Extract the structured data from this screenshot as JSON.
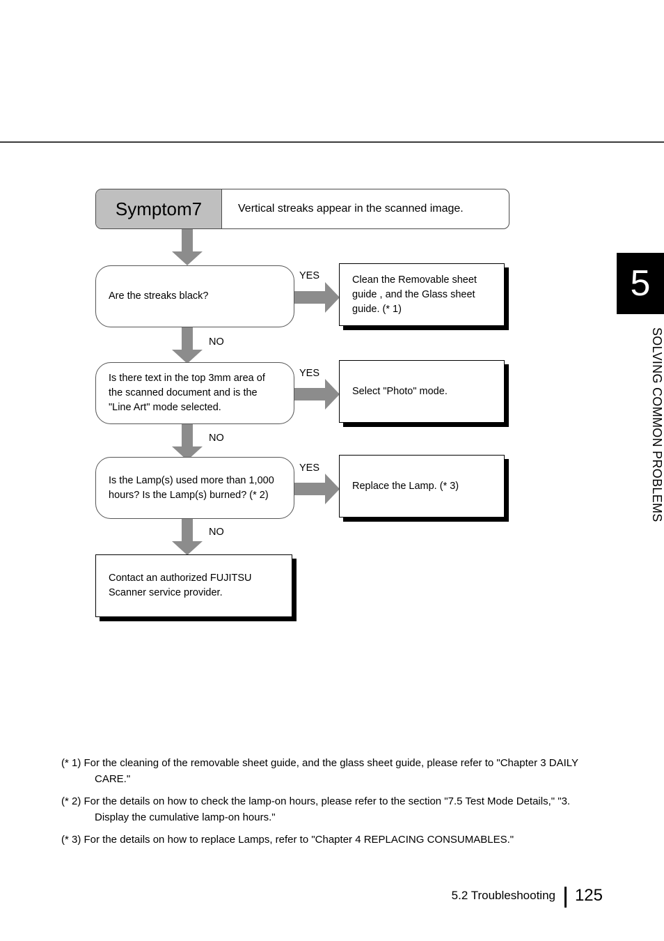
{
  "page": {
    "chapter_tab": {
      "number": "5",
      "label": "SOLVING COMMON PROBLEMS"
    },
    "footer": {
      "section": "5.2  Troubleshooting",
      "page_number": "125"
    }
  },
  "symptom": {
    "title": "Symptom7",
    "description": "Vertical streaks appear in the scanned image."
  },
  "flowchart": {
    "decisions": [
      {
        "text": "Are the streaks black?",
        "yes_label": "YES",
        "no_label": "NO"
      },
      {
        "text": "Is there text in the top 3mm area of\nthe scanned document and is the\n\"Line Art\" mode selected.",
        "yes_label": "YES",
        "no_label": "NO"
      },
      {
        "text": "Is the Lamp(s) used more than 1,000\nhours? Is the Lamp(s) burned? (* 2)",
        "yes_label": "YES",
        "no_label": "NO"
      }
    ],
    "actions": [
      {
        "text": "Clean the Removable sheet\nguide , and the Glass sheet\nguide. (* 1)"
      },
      {
        "text": "Select \"Photo\" mode."
      },
      {
        "text": "Replace the Lamp. (* 3)"
      }
    ],
    "final": {
      "text": "Contact an authorized FUJITSU\nScanner service provider."
    },
    "arrow_color": "#8c8c8c"
  },
  "footnotes": [
    "(* 1) For the cleaning of the removable sheet guide, and the glass sheet guide, please refer to \"Chapter 3 DAILY CARE.\"",
    "(* 2) For the details on how to check the lamp-on hours, please refer to the section \"7.5 Test Mode Details,\" \"3. Display the cumulative lamp-on hours.\"",
    "(* 3) For the details on how to replace Lamps, refer to \"Chapter 4 REPLACING CONSUMABLES.\""
  ]
}
